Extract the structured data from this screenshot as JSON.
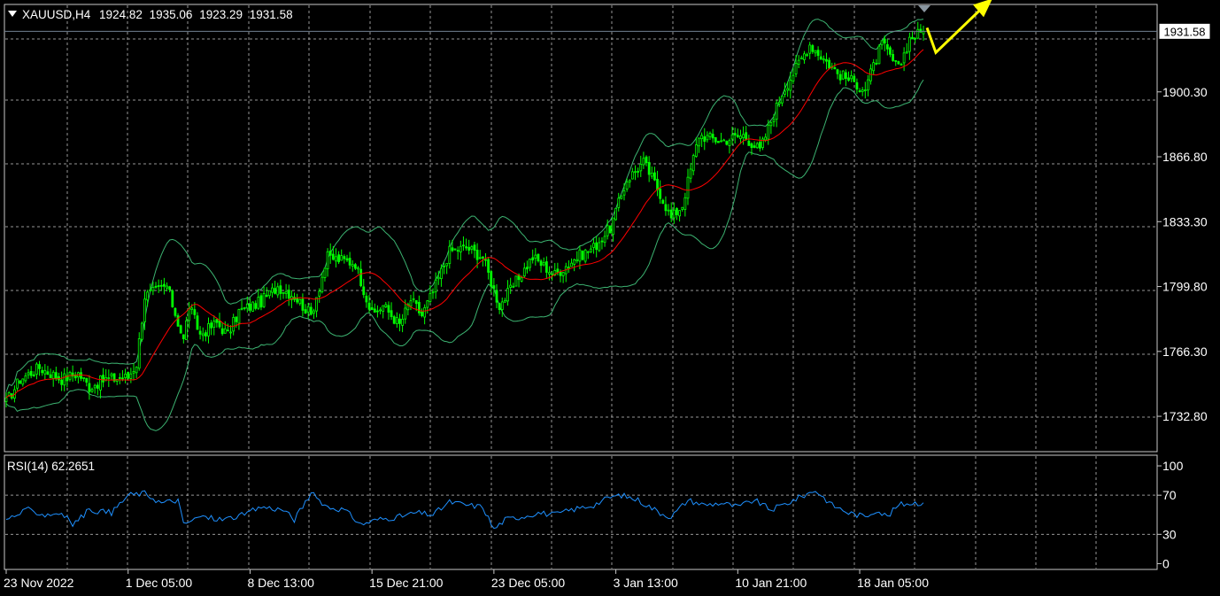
{
  "header": {
    "symbol": "XAUUSD,H4",
    "open": "1924.82",
    "high": "1935.06",
    "low": "1923.29",
    "close": "1931.58"
  },
  "rsi_header": "RSI(14) 62.2651",
  "current_price_label": "1931.58",
  "colors": {
    "background": "#000000",
    "grid": "#c8c8c8",
    "frame": "#c8c8c8",
    "candle": "#00ff00",
    "moving_average": "#ff0000",
    "bollinger": "#3cb371",
    "rsi_line": "#1e90ff",
    "arrow": "#ffff00",
    "price_line": "#708090"
  },
  "chart_data": [
    {
      "type": "candlestick",
      "symbol": "XAUUSD",
      "timeframe": "H4",
      "ylim": [
        1715.0,
        1945.0
      ],
      "y_ticks": [
        "1931.58",
        "1900.30",
        "1866.80",
        "1833.30",
        "1799.80",
        "1766.30",
        "1732.80"
      ],
      "y_tick_values": [
        1931.58,
        1900.3,
        1866.8,
        1833.3,
        1799.8,
        1766.3,
        1732.8
      ],
      "x_ticks": [
        "23 Nov 2022",
        "1 Dec 05:00",
        "8 Dec 13:00",
        "15 Dec 21:00",
        "23 Dec 05:00",
        "3 Jan 13:00",
        "10 Jan 21:00",
        "18 Jan 05:00"
      ],
      "x_tick_bar_index": [
        0,
        44,
        88,
        132,
        176,
        220,
        264,
        308
      ],
      "bar_count": 332,
      "close_path": [
        [
          0,
          1740
        ],
        [
          5,
          1752
        ],
        [
          12,
          1758
        ],
        [
          20,
          1752
        ],
        [
          26,
          1755
        ],
        [
          30,
          1748
        ],
        [
          36,
          1752
        ],
        [
          44,
          1753
        ],
        [
          47,
          1760
        ],
        [
          50,
          1795
        ],
        [
          58,
          1800
        ],
        [
          64,
          1772
        ],
        [
          66,
          1790
        ],
        [
          70,
          1775
        ],
        [
          76,
          1781
        ],
        [
          80,
          1775
        ],
        [
          84,
          1787
        ],
        [
          92,
          1792
        ],
        [
          98,
          1800
        ],
        [
          104,
          1795
        ],
        [
          110,
          1785
        ],
        [
          116,
          1815
        ],
        [
          126,
          1812
        ],
        [
          132,
          1785
        ],
        [
          136,
          1790
        ],
        [
          142,
          1780
        ],
        [
          146,
          1793
        ],
        [
          150,
          1785
        ],
        [
          154,
          1797
        ],
        [
          160,
          1818
        ],
        [
          166,
          1820
        ],
        [
          172,
          1815
        ],
        [
          176,
          1798
        ],
        [
          178,
          1790
        ],
        [
          182,
          1798
        ],
        [
          190,
          1815
        ],
        [
          198,
          1806
        ],
        [
          206,
          1815
        ],
        [
          212,
          1820
        ],
        [
          218,
          1830
        ],
        [
          224,
          1855
        ],
        [
          230,
          1864
        ],
        [
          236,
          1848
        ],
        [
          240,
          1835
        ],
        [
          244,
          1842
        ],
        [
          250,
          1878
        ],
        [
          258,
          1875
        ],
        [
          266,
          1878
        ],
        [
          272,
          1870
        ],
        [
          280,
          1900
        ],
        [
          290,
          1925
        ],
        [
          300,
          1910
        ],
        [
          310,
          1902
        ],
        [
          316,
          1925
        ],
        [
          322,
          1912
        ],
        [
          326,
          1928
        ],
        [
          331,
          1931.58
        ]
      ],
      "series": [
        {
          "name": "XAUUSD,H4",
          "kind": "candles"
        },
        {
          "kind": "moving-average"
        },
        {
          "kind": "bollinger-bands"
        }
      ]
    },
    {
      "type": "line",
      "title": "RSI(14) 62.2651",
      "last_value": 62.2651,
      "ylim": [
        -5,
        110
      ],
      "y_ticks": [
        "100",
        "70",
        "30",
        "0"
      ],
      "y_tick_values": [
        100,
        70,
        30,
        0
      ],
      "path": [
        [
          0,
          45
        ],
        [
          8,
          55
        ],
        [
          14,
          50
        ],
        [
          20,
          52
        ],
        [
          24,
          40
        ],
        [
          30,
          55
        ],
        [
          38,
          52
        ],
        [
          44,
          70
        ],
        [
          50,
          72
        ],
        [
          56,
          62
        ],
        [
          62,
          65
        ],
        [
          64,
          40
        ],
        [
          70,
          48
        ],
        [
          78,
          45
        ],
        [
          86,
          50
        ],
        [
          92,
          58
        ],
        [
          100,
          55
        ],
        [
          104,
          45
        ],
        [
          110,
          72
        ],
        [
          116,
          58
        ],
        [
          122,
          55
        ],
        [
          128,
          40
        ],
        [
          134,
          45
        ],
        [
          142,
          48
        ],
        [
          148,
          52
        ],
        [
          154,
          50
        ],
        [
          160,
          63
        ],
        [
          166,
          60
        ],
        [
          172,
          58
        ],
        [
          176,
          35
        ],
        [
          180,
          45
        ],
        [
          186,
          48
        ],
        [
          192,
          52
        ],
        [
          198,
          50
        ],
        [
          204,
          55
        ],
        [
          212,
          60
        ],
        [
          218,
          68
        ],
        [
          222,
          70
        ],
        [
          228,
          65
        ],
        [
          236,
          52
        ],
        [
          240,
          48
        ],
        [
          246,
          65
        ],
        [
          252,
          60
        ],
        [
          258,
          62
        ],
        [
          264,
          58
        ],
        [
          270,
          65
        ],
        [
          276,
          55
        ],
        [
          282,
          62
        ],
        [
          288,
          70
        ],
        [
          292,
          75
        ],
        [
          298,
          60
        ],
        [
          304,
          52
        ],
        [
          310,
          48
        ],
        [
          314,
          55
        ],
        [
          318,
          48
        ],
        [
          322,
          60
        ],
        [
          326,
          62
        ],
        [
          331,
          62.27
        ]
      ]
    }
  ]
}
